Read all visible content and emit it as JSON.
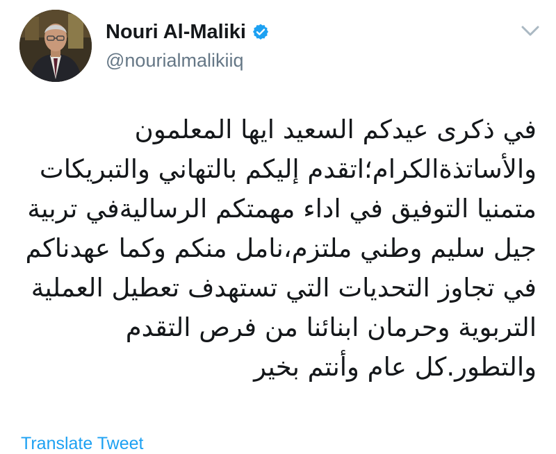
{
  "tweet": {
    "author": {
      "display_name": "Nouri Al-Maliki",
      "handle": "@nourialmalikiiq",
      "verified": true
    },
    "body_lines": [
      "في ذكرى عيدكم السعيد ايها المعلمون",
      "والأساتذةالكرام؛اتقدم إليكم بالتهاني والتبريكات",
      "متمنيا التوفيق في اداء مهمتكم الرساليةفي تربية",
      "جيل سليم وطني ملتزم،نامل منكم وكما عهدناكم",
      "في تجاوز التحديات التي تستهدف تعطيل العملية",
      "التربوية وحرمان ابنائنا من فرص التقدم",
      "والتطور.كل عام وأنتم بخير"
    ],
    "translate_label": "Translate Tweet"
  },
  "colors": {
    "text_primary": "#14171a",
    "text_secondary": "#657786",
    "accent": "#1da1f2",
    "chevron": "#aab8c2"
  },
  "icons": {
    "verified": "verified-badge-icon",
    "menu": "chevron-down-icon"
  }
}
